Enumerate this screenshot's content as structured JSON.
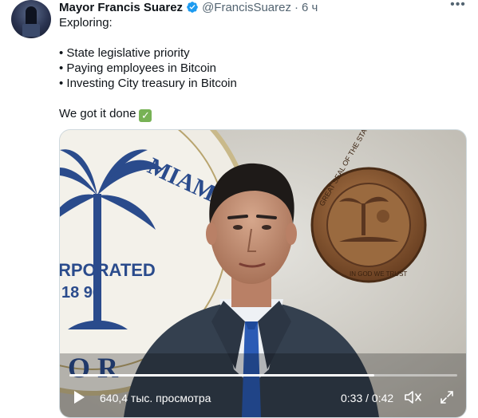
{
  "tweet": {
    "author_name": "Mayor Francis Suarez",
    "verified_icon": "verified-badge-icon",
    "handle": "@FrancisSuarez",
    "separator": "·",
    "time": "6 ч",
    "more_icon": "more-horizontal-icon",
    "text_intro": "Exploring:",
    "bullets": [
      "State legislative priority",
      "Paying employees in Bitcoin",
      "Investing City treasury in Bitcoin"
    ],
    "text_outro": "We got it done",
    "check_icon": "check-mark-button-emoji-icon"
  },
  "video": {
    "seal_left_text_1": "MIAMI",
    "seal_left_text_2": "RPORATED",
    "seal_left_text_3": "18   96",
    "seal_left_text_4": "O R",
    "seal_right_text_1": "GREAT SEAL OF THE STATE OF FLORIDA",
    "seal_right_text_2": "IN GOD WE TRUST",
    "views": "640,4 тыс. просмотра",
    "current_time": "0:33",
    "time_separator": " / ",
    "duration": "0:42",
    "progress": 0.786,
    "icons": {
      "play": "play-icon",
      "volume": "volume-icon",
      "fullscreen": "fullscreen-icon"
    }
  },
  "colors": {
    "accent": "#1d9bf0",
    "text_primary": "#0f1419",
    "text_secondary": "#536471",
    "check_green": "#77b255"
  }
}
